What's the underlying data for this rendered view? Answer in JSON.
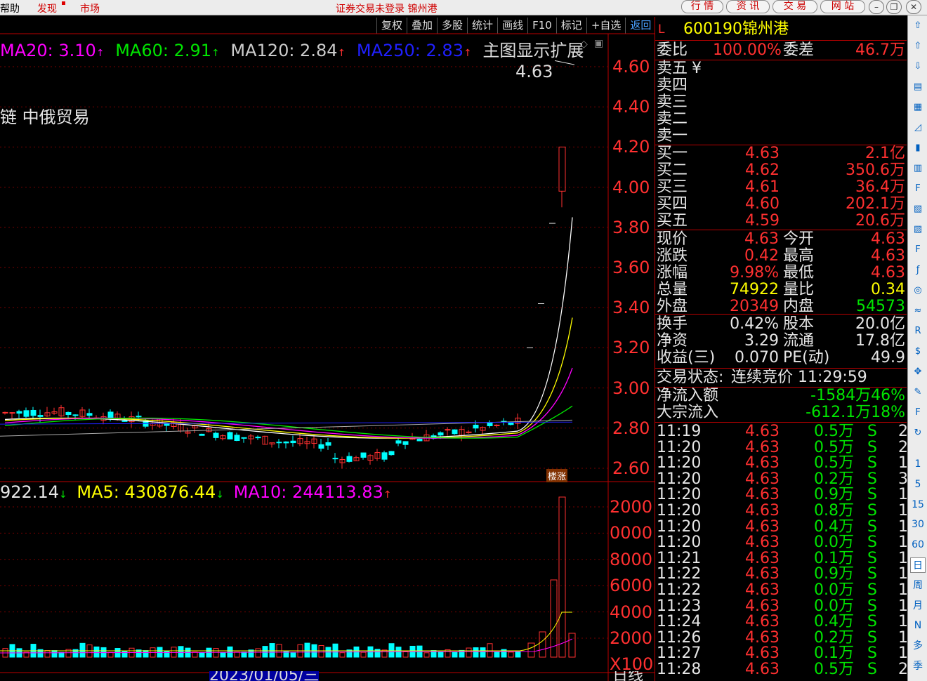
{
  "topbar": {
    "help": "帮助",
    "discover": "发现",
    "market": "市场",
    "title": "证券交易未登录  锦州港",
    "buttons": [
      "行 情",
      "资 讯",
      "交 易",
      "网 站"
    ]
  },
  "chart_toolbar": [
    "复权",
    "叠加",
    "多股",
    "统计",
    "画线",
    "F10",
    "标记",
    "+自选",
    "返回"
  ],
  "main_ma": {
    "ma20": "MA20: 3.10",
    "ma60": "MA60: 2.91",
    "ma120": "MA120: 2.84",
    "ma250": "MA250: 2.83",
    "main_ext": "主图显示扩展",
    "price_marker": "4.63",
    "concept": "链 中俄贸易",
    "badge": "楼涨"
  },
  "vol_ma": {
    "vol": "922.14",
    "ma5": "MA5: 430876.44",
    "ma10": "MA10: 244113.83"
  },
  "price_axis": [
    "4.60",
    "4.40",
    "4.20",
    "4.00",
    "3.80",
    "3.60",
    "3.40",
    "3.20",
    "3.00",
    "2.80",
    "2.60"
  ],
  "vol_axis": [
    "2000",
    "0000",
    "8000",
    "6000",
    "4000",
    "2000",
    "X100"
  ],
  "date_label": "2023/01/05/三",
  "period_label": "日线",
  "quote": {
    "flag": "L",
    "code": "600190",
    "name": "锦州港",
    "ratio_label": "委比",
    "ratio": "100.00%",
    "diff_label": "委差",
    "diff": "46.7万",
    "sells": [
      {
        "label": "卖五",
        "price": "¥",
        "vol": ""
      },
      {
        "label": "卖四",
        "price": "",
        "vol": ""
      },
      {
        "label": "卖三",
        "price": "",
        "vol": ""
      },
      {
        "label": "卖二",
        "price": "",
        "vol": ""
      },
      {
        "label": "卖一",
        "price": "",
        "vol": ""
      }
    ],
    "buys": [
      {
        "label": "买一",
        "price": "4.63",
        "vol": "2.1亿"
      },
      {
        "label": "买二",
        "price": "4.62",
        "vol": "350.6万"
      },
      {
        "label": "买三",
        "price": "4.61",
        "vol": "36.4万"
      },
      {
        "label": "买四",
        "price": "4.60",
        "vol": "202.1万"
      },
      {
        "label": "买五",
        "price": "4.59",
        "vol": "20.6万"
      }
    ],
    "stats": [
      {
        "l1": "现价",
        "v1": "4.63",
        "l2": "今开",
        "v2": "4.63"
      },
      {
        "l1": "涨跌",
        "v1": "0.42",
        "l2": "最高",
        "v2": "4.63"
      },
      {
        "l1": "涨幅",
        "v1": "9.98%",
        "l2": "最低",
        "v2": "4.63"
      },
      {
        "l1": "总量",
        "v1": "74922",
        "l2": "量比",
        "v2": "0.34"
      },
      {
        "l1": "外盘",
        "v1": "20349",
        "l2": "内盘",
        "v2": "54573"
      }
    ],
    "fund": [
      {
        "l1": "换手",
        "v1": "0.42%",
        "l2": "股本",
        "v2": "20.0亿"
      },
      {
        "l1": "净资",
        "v1": "3.29",
        "l2": "流通",
        "v2": "17.8亿"
      },
      {
        "l1": "收益(三)",
        "v1": "0.070",
        "l2": "PE(动)",
        "v2": "49.9"
      }
    ],
    "status_label": "交易状态:",
    "status": "连续竞价 11:29:59",
    "inflow_label": "净流入额",
    "inflow": "-1584万46%",
    "block_label": "大宗流入",
    "block": "-612.1万18%"
  },
  "ticks": [
    {
      "t": "11:19",
      "p": "4.63",
      "v": "0.5万",
      "s": "S",
      "n": "2"
    },
    {
      "t": "11:20",
      "p": "4.63",
      "v": "0.5万",
      "s": "S",
      "n": "2"
    },
    {
      "t": "11:20",
      "p": "4.63",
      "v": "0.5万",
      "s": "S",
      "n": "1"
    },
    {
      "t": "11:20",
      "p": "4.63",
      "v": "0.2万",
      "s": "S",
      "n": "3"
    },
    {
      "t": "11:20",
      "p": "4.63",
      "v": "0.9万",
      "s": "S",
      "n": "1"
    },
    {
      "t": "11:20",
      "p": "4.63",
      "v": "0.8万",
      "s": "S",
      "n": "1"
    },
    {
      "t": "11:20",
      "p": "4.63",
      "v": "0.4万",
      "s": "S",
      "n": "1"
    },
    {
      "t": "11:20",
      "p": "4.63",
      "v": "0.0万",
      "s": "S",
      "n": "1"
    },
    {
      "t": "11:21",
      "p": "4.63",
      "v": "0.1万",
      "s": "S",
      "n": "1"
    },
    {
      "t": "11:22",
      "p": "4.63",
      "v": "0.9万",
      "s": "S",
      "n": "1"
    },
    {
      "t": "11:22",
      "p": "4.63",
      "v": "0.0万",
      "s": "S",
      "n": "1"
    },
    {
      "t": "11:23",
      "p": "4.63",
      "v": "0.0万",
      "s": "S",
      "n": "1"
    },
    {
      "t": "11:24",
      "p": "4.63",
      "v": "0.4万",
      "s": "S",
      "n": "1"
    },
    {
      "t": "11:26",
      "p": "4.63",
      "v": "0.2万",
      "s": "S",
      "n": "1"
    },
    {
      "t": "11:27",
      "p": "4.63",
      "v": "0.1万",
      "s": "S",
      "n": "1"
    },
    {
      "t": "11:28",
      "p": "4.63",
      "v": "0.5万",
      "s": "S",
      "n": "2"
    }
  ],
  "sidebar_bottom": [
    "1",
    "5",
    "15",
    "30",
    "60",
    "日",
    "周",
    "月",
    "N",
    "多",
    "季"
  ],
  "sidebar_icons": [
    "up-arrow-icon",
    "up-arrow-icon",
    "down-arrow-icon",
    "list-icon",
    "grid-icon",
    "line-chart-icon",
    "candle-icon",
    "book-icon",
    "f10-icon",
    "building-icon",
    "news-icon",
    "f12-icon",
    "fx-icon",
    "circle-icon",
    "wave-icon",
    "rsi-icon",
    "dollar-icon",
    "move-icon",
    "pen-icon",
    "f5-icon",
    "refresh-icon"
  ]
}
